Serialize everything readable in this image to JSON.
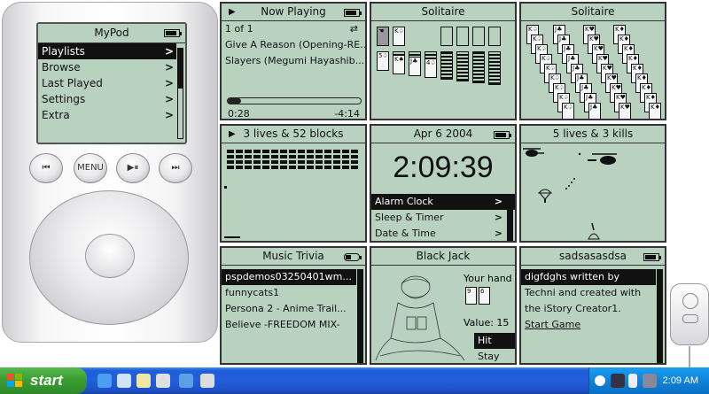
{
  "mypod": {
    "title": "MyPod",
    "menu": [
      {
        "label": "Playlists"
      },
      {
        "label": "Browse"
      },
      {
        "label": "Last Played"
      },
      {
        "label": "Settings"
      },
      {
        "label": "Extra"
      }
    ],
    "chevron": ">",
    "buttons": {
      "prev": "⏮",
      "menu": "MENU",
      "play": "▶⏸",
      "next": "⏭"
    }
  },
  "panels": {
    "now_playing": {
      "title": "Now Playing",
      "track_index": "1 of 1",
      "repeat_icon": "⇄",
      "song": "Give A Reason (Opening-RE...",
      "artist": "Slayers (Megumi Hayashib...",
      "elapsed": "0:28",
      "remaining": "-4:14",
      "progress": 0.1
    },
    "solitaire1": {
      "title": "Solitaire"
    },
    "solitaire2": {
      "title": "Solitaire"
    },
    "bricks": {
      "title": "3 lives & 52 blocks"
    },
    "clock": {
      "date": "Apr 6 2004",
      "time": "2:09:39",
      "menu": [
        {
          "label": "Alarm Clock"
        },
        {
          "label": "Sleep & Timer"
        },
        {
          "label": "Date & Time"
        }
      ]
    },
    "shooter": {
      "title": "5 lives & 3 kills"
    },
    "trivia": {
      "title": "Music Trivia",
      "items": [
        {
          "label": "pspdemos03250401wm..."
        },
        {
          "label": "funnycats1"
        },
        {
          "label": "Persona 2 - Anime Trail..."
        },
        {
          "label": "Believe -FREEDOM MIX-"
        }
      ]
    },
    "blackjack": {
      "title": "Black Jack",
      "your_hand": "Your hand",
      "value": "Value: 15",
      "hit": "Hit",
      "stay": "Stay",
      "cards": [
        "9",
        "6"
      ]
    },
    "story": {
      "title": "sadsasasdsa",
      "lines": [
        {
          "label": "digfdghs written by"
        },
        {
          "label": "Techni and created with"
        },
        {
          "label": "the iStory Creator1."
        },
        {
          "label": "Start Game"
        }
      ]
    }
  },
  "taskbar": {
    "start_label": "start",
    "clock": "2:09 AM"
  }
}
